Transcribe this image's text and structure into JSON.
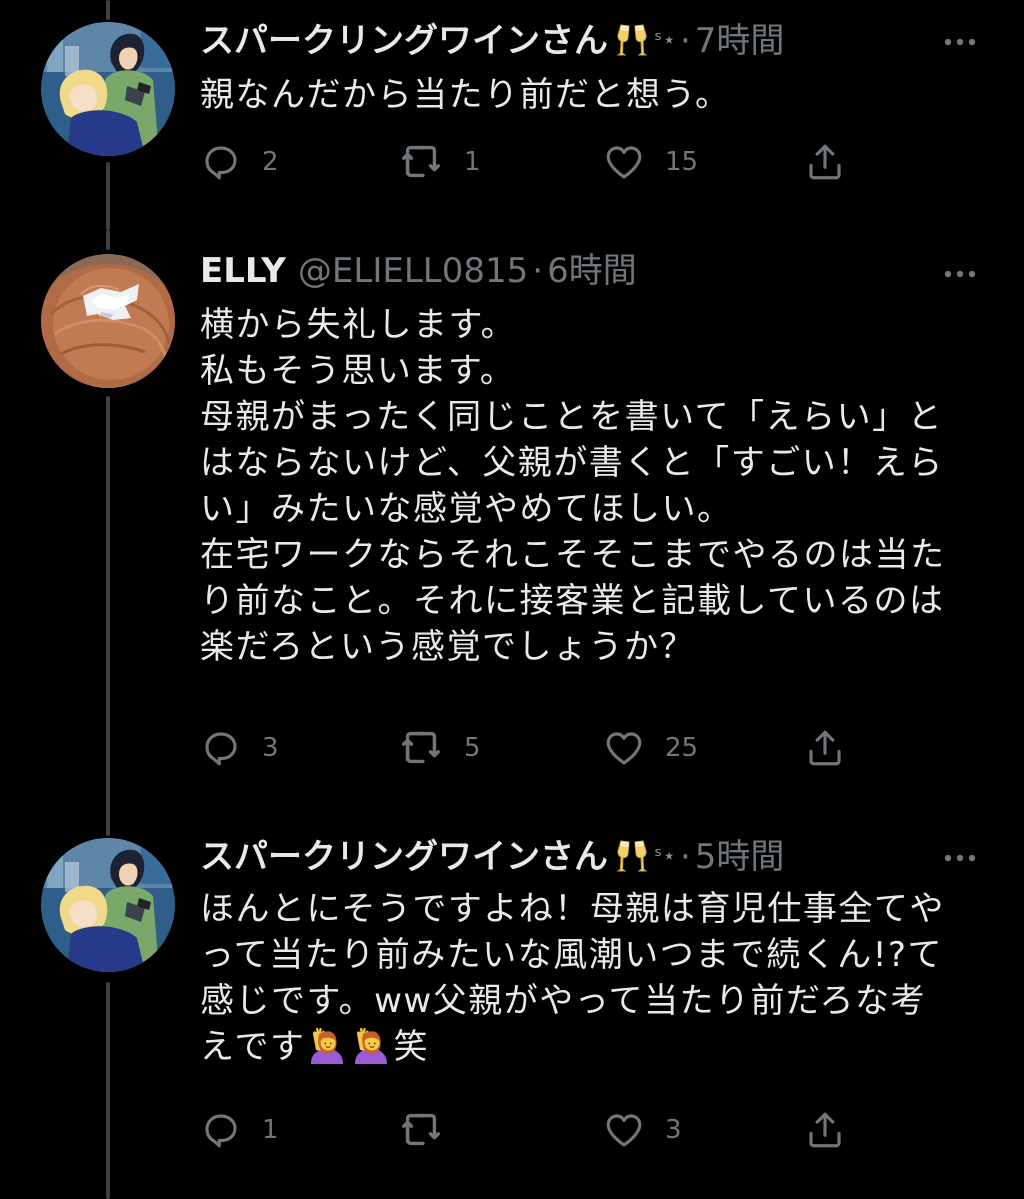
{
  "colors": {
    "background": "#000000",
    "primary_text": "#e7e9ea",
    "secondary_text": "#71767b",
    "thread_line": "#3e4144"
  },
  "tweets": [
    {
      "display_name": "スパークリングワインさん",
      "name_emojis": [
        "clinking-glasses-emoji",
        "sparkles-emoji"
      ],
      "handle": "",
      "time": "7時間",
      "text_lines": [
        "親なんだから当たり前だと想う。"
      ],
      "reply_count": "2",
      "retweet_count": "1",
      "like_count": "15",
      "avatar": "anime-illustration-avatar"
    },
    {
      "display_name": "ELLY",
      "handle": "@ELIELL0815",
      "time": "6時間",
      "text_lines": [
        "横から失礼します。",
        "私もそう思います。",
        "母親がまったく同じことを書いて「えらい」と",
        "はならないけど、父親が書くと「すごい！えら",
        "い」みたいな感覚やめてほしい。",
        "在宅ワークならそれこそそこまでやるのは当た",
        "り前なこと。それに接客業と記載しているのは",
        "楽だろという感覚でしょうか？"
      ],
      "reply_count": "3",
      "retweet_count": "5",
      "like_count": "25",
      "avatar": "hair-clip-photo-avatar"
    },
    {
      "display_name": "スパークリングワインさん",
      "name_emojis": [
        "clinking-glasses-emoji",
        "sparkles-emoji"
      ],
      "handle": "",
      "time": "5時間",
      "text_lines": [
        "ほんとにそうですよね！母親は育児仕事全てや",
        "って当たり前みたいな風潮いつまで続くん!?て",
        "感じです。ww父親がやって当たり前だろな考",
        "えです",
        "笑"
      ],
      "text_emojis": [
        "person-raising-hand-emoji",
        "person-raising-hand-emoji"
      ],
      "reply_count": "1",
      "retweet_count": "",
      "like_count": "3",
      "avatar": "anime-illustration-avatar"
    }
  ],
  "icons": {
    "reply": "reply-icon",
    "retweet": "retweet-icon",
    "like": "heart-icon",
    "share": "share-icon",
    "more": "more-icon"
  }
}
